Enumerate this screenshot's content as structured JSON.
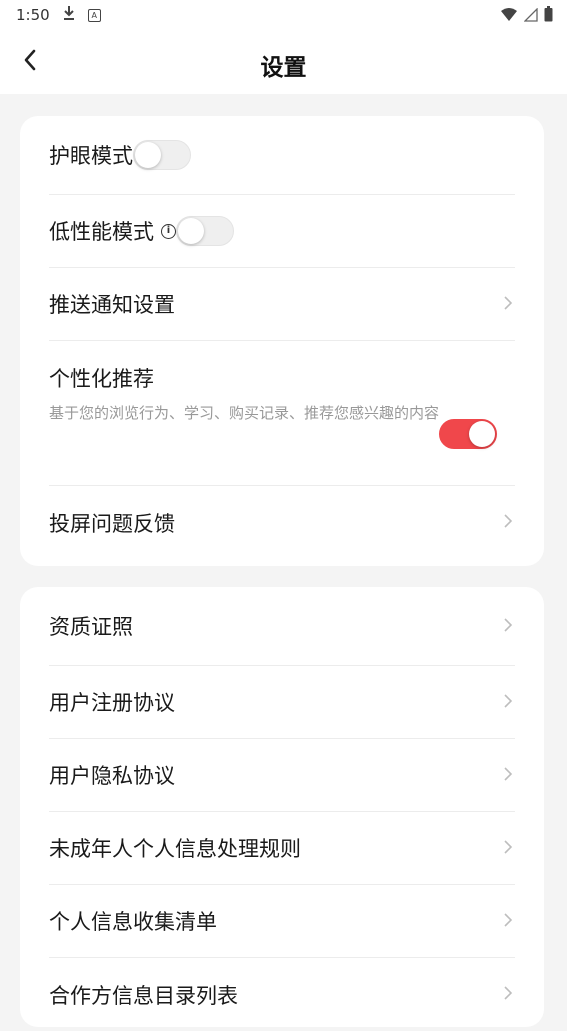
{
  "status_bar": {
    "time": "1:50",
    "icons": [
      "download-icon",
      "a-box-icon",
      "wifi-icon",
      "signal-icon",
      "battery-icon"
    ]
  },
  "header": {
    "title": "设置",
    "back_icon": "chevron-left-icon"
  },
  "accent_color": "#f0474b",
  "section1": {
    "items": [
      {
        "label": "护眼模式",
        "control": "toggle",
        "on": false
      },
      {
        "label": "低性能模式",
        "control": "toggle",
        "on": false,
        "info_icon": "info-icon"
      },
      {
        "label": "推送通知设置",
        "control": "chevron"
      },
      {
        "label": "个性化推荐",
        "description": "基于您的浏览行为、学习、购买记录、推荐您感兴趣的内容",
        "control": "toggle",
        "on": true
      },
      {
        "label": "投屏问题反馈",
        "control": "chevron"
      }
    ]
  },
  "section2": {
    "items": [
      {
        "label": "资质证照",
        "control": "chevron"
      },
      {
        "label": "用户注册协议",
        "control": "chevron"
      },
      {
        "label": "用户隐私协议",
        "control": "chevron"
      },
      {
        "label": "未成年人个人信息处理规则",
        "control": "chevron"
      },
      {
        "label": "个人信息收集清单",
        "control": "chevron"
      },
      {
        "label": "合作方信息目录列表",
        "control": "chevron"
      }
    ]
  }
}
